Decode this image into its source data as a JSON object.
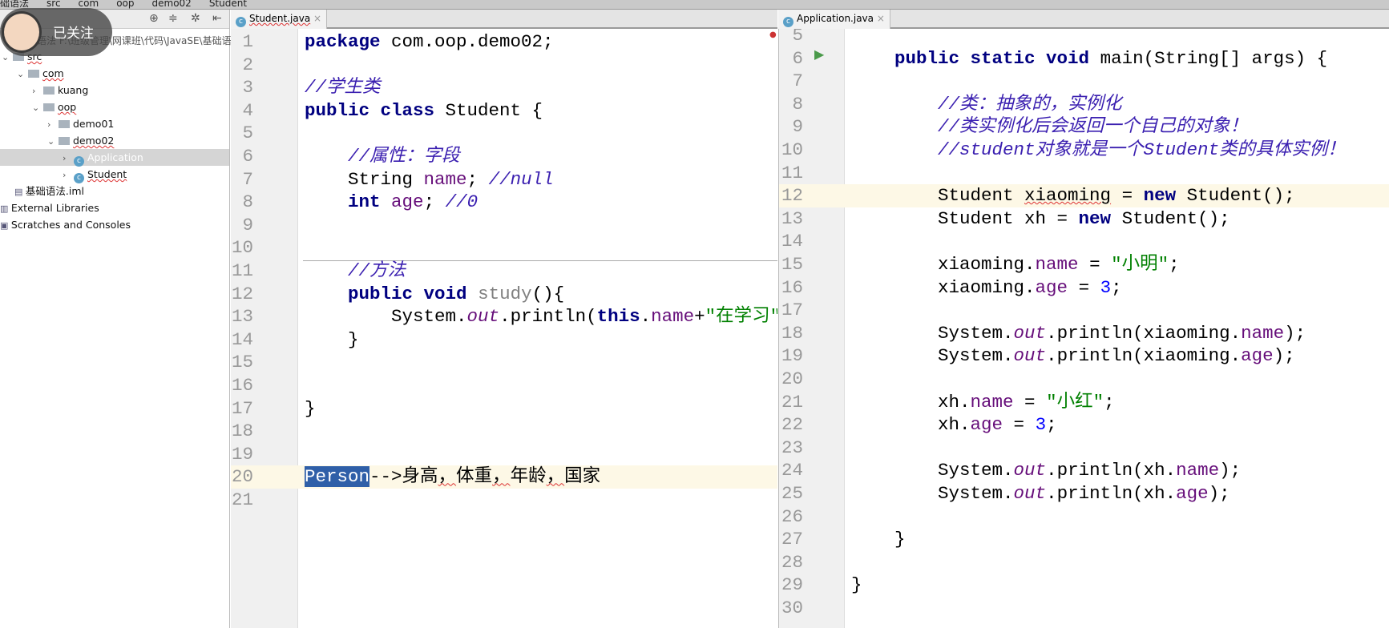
{
  "breadcrumb": [
    "础语法",
    "src",
    "com",
    "oop",
    "demo02",
    "Student"
  ],
  "overlay": {
    "follow_label": "已关注"
  },
  "project": {
    "root_path": "语法  F:\\班级管理\\网课班\\代码\\JavaSE\\基础语",
    "items": [
      {
        "label": "src",
        "depth": 0,
        "arrow": "v",
        "icon": "folder"
      },
      {
        "label": "com",
        "depth": 1,
        "arrow": "v",
        "icon": "folder"
      },
      {
        "label": "kuang",
        "depth": 2,
        "arrow": ">",
        "icon": "folder"
      },
      {
        "label": "oop",
        "depth": 2,
        "arrow": "v",
        "icon": "folder"
      },
      {
        "label": "demo01",
        "depth": 3,
        "arrow": ">",
        "icon": "folder"
      },
      {
        "label": "demo02",
        "depth": 3,
        "arrow": "v",
        "icon": "folder"
      },
      {
        "label": "Application",
        "depth": 4,
        "arrow": ">",
        "icon": "class",
        "selected": true
      },
      {
        "label": "Student",
        "depth": 4,
        "arrow": ">",
        "icon": "class"
      },
      {
        "label": "基础语法.iml",
        "depth": 0,
        "arrow": "",
        "icon": "file"
      },
      {
        "label": "External Libraries",
        "depth": -1,
        "arrow": "",
        "icon": "library"
      },
      {
        "label": "Scratches and Consoles",
        "depth": -1,
        "arrow": "",
        "icon": "scratch"
      }
    ]
  },
  "left_editor": {
    "tab": "Student.java",
    "current_line": 20,
    "lines": [
      {
        "n": 1,
        "t": [
          [
            "package",
            "kw"
          ],
          [
            " com.oop.demo02;",
            ""
          ]
        ]
      },
      {
        "n": 2,
        "t": []
      },
      {
        "n": 3,
        "t": [
          [
            "//学生类",
            "cm"
          ]
        ]
      },
      {
        "n": 4,
        "t": [
          [
            "public class",
            "kw"
          ],
          [
            " Student {",
            ""
          ]
        ]
      },
      {
        "n": 5,
        "t": []
      },
      {
        "n": 6,
        "t": [
          [
            "    ",
            ""
          ],
          [
            "//属性：字段",
            "cm"
          ]
        ]
      },
      {
        "n": 7,
        "t": [
          [
            "    String ",
            ""
          ],
          [
            "name",
            "fld"
          ],
          [
            "; ",
            ""
          ],
          [
            "//null",
            "cm"
          ]
        ]
      },
      {
        "n": 8,
        "t": [
          [
            "    ",
            ""
          ],
          [
            "int",
            "kw"
          ],
          [
            " ",
            ""
          ],
          [
            "age",
            "fld"
          ],
          [
            "; ",
            ""
          ],
          [
            "//0",
            "cm"
          ]
        ]
      },
      {
        "n": 9,
        "t": []
      },
      {
        "n": 10,
        "t": []
      },
      {
        "n": 11,
        "t": [
          [
            "    ",
            ""
          ],
          [
            "//方法",
            "cm"
          ]
        ]
      },
      {
        "n": 12,
        "t": [
          [
            "    ",
            ""
          ],
          [
            "public void",
            "kw"
          ],
          [
            " ",
            ""
          ],
          [
            "study",
            "gr"
          ],
          [
            "(){",
            ""
          ]
        ]
      },
      {
        "n": 13,
        "t": [
          [
            "        System.",
            ""
          ],
          [
            "out",
            "st"
          ],
          [
            ".println(",
            ""
          ],
          [
            "this",
            "kw"
          ],
          [
            ".",
            ""
          ],
          [
            "name",
            "fld"
          ],
          [
            "+",
            ""
          ],
          [
            "\"在学习\"",
            "str"
          ],
          [
            ");",
            ""
          ]
        ]
      },
      {
        "n": 14,
        "t": [
          [
            "    }",
            ""
          ]
        ]
      },
      {
        "n": 15,
        "t": []
      },
      {
        "n": 16,
        "t": []
      },
      {
        "n": 17,
        "t": [
          [
            "}",
            ""
          ]
        ]
      },
      {
        "n": 18,
        "t": []
      },
      {
        "n": 19,
        "t": []
      },
      {
        "n": 20,
        "t": [
          [
            "Person",
            "sel"
          ],
          [
            "-->身高",
            ""
          ],
          [
            "，",
            "wav"
          ],
          [
            "体重",
            ""
          ],
          [
            "，",
            "wav"
          ],
          [
            "年龄",
            ""
          ],
          [
            "，",
            "wav"
          ],
          [
            "国家",
            ""
          ]
        ]
      },
      {
        "n": 21,
        "t": []
      }
    ]
  },
  "right_editor": {
    "tab": "Application.java",
    "current_line": 12,
    "lines": [
      {
        "n": 5,
        "t": []
      },
      {
        "n": 6,
        "t": [
          [
            "    ",
            ""
          ],
          [
            "public static void",
            "kw"
          ],
          [
            " main(String[] args) {",
            ""
          ]
        ]
      },
      {
        "n": 7,
        "t": []
      },
      {
        "n": 8,
        "t": [
          [
            "        ",
            ""
          ],
          [
            "//类：抽象的，实例化",
            "cm"
          ]
        ]
      },
      {
        "n": 9,
        "t": [
          [
            "        ",
            ""
          ],
          [
            "//类实例化后会返回一个自己的对象！",
            "cm"
          ]
        ]
      },
      {
        "n": 10,
        "t": [
          [
            "        ",
            ""
          ],
          [
            "//student对象就是一个Student类的具体实例！",
            "cm"
          ]
        ]
      },
      {
        "n": 11,
        "t": []
      },
      {
        "n": 12,
        "t": [
          [
            "        Student ",
            ""
          ],
          [
            "xiaoming",
            "wav"
          ],
          [
            " = ",
            ""
          ],
          [
            "new",
            "kw"
          ],
          [
            " Student();",
            ""
          ]
        ]
      },
      {
        "n": 13,
        "t": [
          [
            "        Student xh = ",
            ""
          ],
          [
            "new",
            "kw"
          ],
          [
            " Student();",
            ""
          ]
        ]
      },
      {
        "n": 14,
        "t": []
      },
      {
        "n": 15,
        "t": [
          [
            "        xiaoming.",
            ""
          ],
          [
            "name",
            "fld"
          ],
          [
            " = ",
            ""
          ],
          [
            "\"小明\"",
            "str"
          ],
          [
            ";",
            ""
          ]
        ]
      },
      {
        "n": 16,
        "t": [
          [
            "        xiaoming.",
            ""
          ],
          [
            "age",
            "fld"
          ],
          [
            " = ",
            ""
          ],
          [
            "3",
            "num"
          ],
          [
            ";",
            ""
          ]
        ]
      },
      {
        "n": 17,
        "t": []
      },
      {
        "n": 18,
        "t": [
          [
            "        System.",
            ""
          ],
          [
            "out",
            "st"
          ],
          [
            ".println(xiaoming.",
            ""
          ],
          [
            "name",
            "fld"
          ],
          [
            ");",
            ""
          ]
        ]
      },
      {
        "n": 19,
        "t": [
          [
            "        System.",
            ""
          ],
          [
            "out",
            "st"
          ],
          [
            ".println(xiaoming.",
            ""
          ],
          [
            "age",
            "fld"
          ],
          [
            ");",
            ""
          ]
        ]
      },
      {
        "n": 20,
        "t": []
      },
      {
        "n": 21,
        "t": [
          [
            "        xh.",
            ""
          ],
          [
            "name",
            "fld"
          ],
          [
            " = ",
            ""
          ],
          [
            "\"小红\"",
            "str"
          ],
          [
            ";",
            ""
          ]
        ]
      },
      {
        "n": 22,
        "t": [
          [
            "        xh.",
            ""
          ],
          [
            "age",
            "fld"
          ],
          [
            " = ",
            ""
          ],
          [
            "3",
            "num"
          ],
          [
            ";",
            ""
          ]
        ]
      },
      {
        "n": 23,
        "t": []
      },
      {
        "n": 24,
        "t": [
          [
            "        System.",
            ""
          ],
          [
            "out",
            "st"
          ],
          [
            ".println(xh.",
            ""
          ],
          [
            "name",
            "fld"
          ],
          [
            ");",
            ""
          ]
        ]
      },
      {
        "n": 25,
        "t": [
          [
            "        System.",
            ""
          ],
          [
            "out",
            "st"
          ],
          [
            ".println(xh.",
            ""
          ],
          [
            "age",
            "fld"
          ],
          [
            ");",
            ""
          ]
        ]
      },
      {
        "n": 26,
        "t": []
      },
      {
        "n": 27,
        "t": [
          [
            "    }",
            ""
          ]
        ]
      },
      {
        "n": 28,
        "t": []
      },
      {
        "n": 29,
        "t": [
          [
            "}",
            ""
          ]
        ]
      },
      {
        "n": 30,
        "t": []
      }
    ]
  }
}
